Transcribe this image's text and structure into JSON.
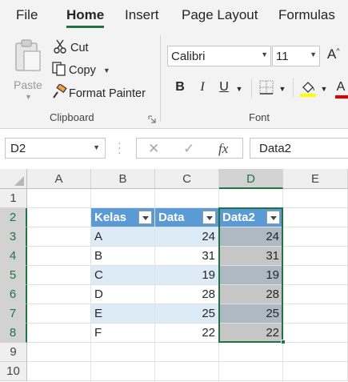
{
  "ribbon_tabs": [
    {
      "label": "File",
      "active": false
    },
    {
      "label": "Home",
      "active": true
    },
    {
      "label": "Insert",
      "active": false
    },
    {
      "label": "Page Layout",
      "active": false
    },
    {
      "label": "Formulas",
      "active": false
    }
  ],
  "clipboard": {
    "paste_label": "Paste",
    "cut_label": "Cut",
    "copy_label": "Copy",
    "format_painter_label": "Format Painter",
    "group_label": "Clipboard"
  },
  "font": {
    "family": "Calibri",
    "size": "11",
    "group_label": "Font",
    "bold_label": "B",
    "italic_label": "I",
    "underline_label": "U",
    "grow_label": "A",
    "font_color_label": "A"
  },
  "formula_bar": {
    "name_box": "D2",
    "cancel_icon": "x-icon",
    "enter_icon": "check-icon",
    "function_label": "fx",
    "formula": "Data2"
  },
  "columns": [
    "A",
    "B",
    "C",
    "D",
    "E"
  ],
  "rows": [
    "1",
    "2",
    "3",
    "4",
    "5",
    "6",
    "7",
    "8",
    "9",
    "10"
  ],
  "table": {
    "headers": [
      "Kelas",
      "Data",
      "Data2"
    ],
    "rows": [
      [
        "A",
        "24",
        "24"
      ],
      [
        "B",
        "31",
        "31"
      ],
      [
        "C",
        "19",
        "19"
      ],
      [
        "D",
        "28",
        "28"
      ],
      [
        "E",
        "25",
        "25"
      ],
      [
        "F",
        "22",
        "22"
      ]
    ]
  },
  "colors": {
    "accent": "#217346",
    "table_header": "#5b9bd5",
    "table_band": "#ddebf7",
    "selection_fill": "#c6c6c6",
    "font_color_bar": "#e00000",
    "highlight_bar": "#ffff00"
  }
}
